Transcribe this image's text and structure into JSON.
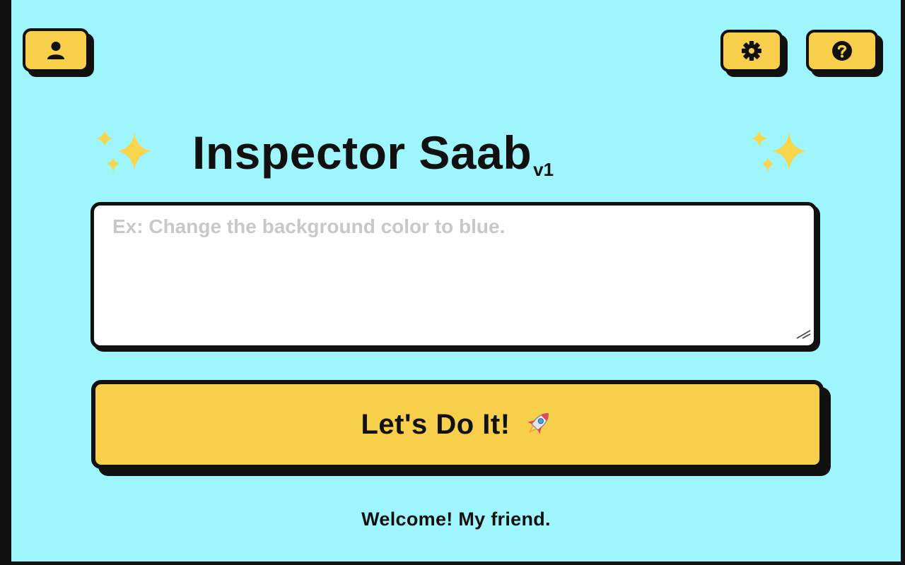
{
  "header": {
    "profile_icon": "user-icon",
    "settings_icon": "gear-icon",
    "help_icon": "help-icon"
  },
  "title": {
    "text": "Inspector Saab",
    "version": "v1",
    "decoration_icon": "sparkles-icon"
  },
  "prompt": {
    "value": "",
    "placeholder": "Ex: Change the background color to blue."
  },
  "action": {
    "label": "Let's Do It!",
    "icon": "rocket-icon"
  },
  "footer": {
    "welcome": "Welcome! My friend."
  },
  "colors": {
    "background": "#9ef5fb",
    "accent": "#f8cf4a",
    "outline": "#111111",
    "placeholder": "#c8c8c8"
  }
}
